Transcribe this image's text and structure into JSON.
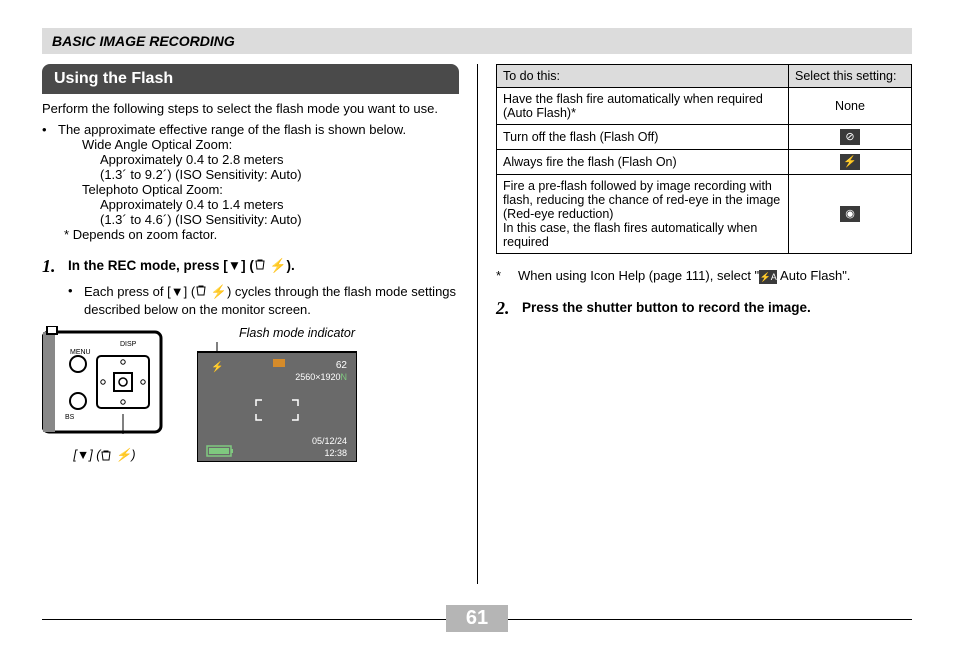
{
  "header": "BASIC IMAGE RECORDING",
  "section_title": "Using the Flash",
  "intro": "Perform the following steps to select the flash mode you want to use.",
  "bullet1": "The approximate effective range of the flash is shown below.",
  "wide_label": "Wide Angle Optical Zoom:",
  "wide_range": "Approximately 0.4 to 2.8 meters",
  "wide_detail": "(1.3´ to 9.2´) (ISO Sensitivity: Auto)",
  "tele_label": "Telephoto Optical Zoom:",
  "tele_range": "Approximately 0.4 to 1.4 meters",
  "tele_detail": "(1.3´ to 4.6´) (ISO Sensitivity: Auto)",
  "depends": "Depends on zoom factor.",
  "star": "*",
  "step1_num": "1.",
  "step1_text_a": "In the REC mode, press [",
  "step1_text_b": "] (",
  "step1_text_c": ").",
  "step1_sub_a": "Each press of [",
  "step1_sub_b": "] (",
  "step1_sub_c": ") cycles through the flash mode settings described below on the monitor screen.",
  "flash_indicator": "Flash mode indicator",
  "cam_caption_a": "[",
  "cam_caption_b": "] (",
  "cam_caption_c": ")",
  "table": {
    "h1": "To do this:",
    "h2": "Select this setting:",
    "r1c1": "Have the flash fire automatically when required (Auto Flash)*",
    "r1c2": "None",
    "r2c1": "Turn off the flash (Flash Off)",
    "r3c1": "Always fire the flash (Flash On)",
    "r4c1": "Fire a pre-flash followed by image recording with flash, reducing the chance of red-eye in the image (Red-eye reduction)\nIn this case, the flash fires automatically when required"
  },
  "icon_off_glyph": "⊘",
  "icon_on_glyph": "⚡",
  "icon_eye_glyph": "◉",
  "right_note_a": "When using Icon Help (page 111), select \"",
  "right_note_b": " Auto Flash\".",
  "step2_num": "2.",
  "step2_text": "Press the shutter button to record the image.",
  "page_number": "61",
  "screen": {
    "shots": "62",
    "res": "2560×1920",
    "res_suffix": "N",
    "date": "05/12/24",
    "time": "12:38"
  }
}
